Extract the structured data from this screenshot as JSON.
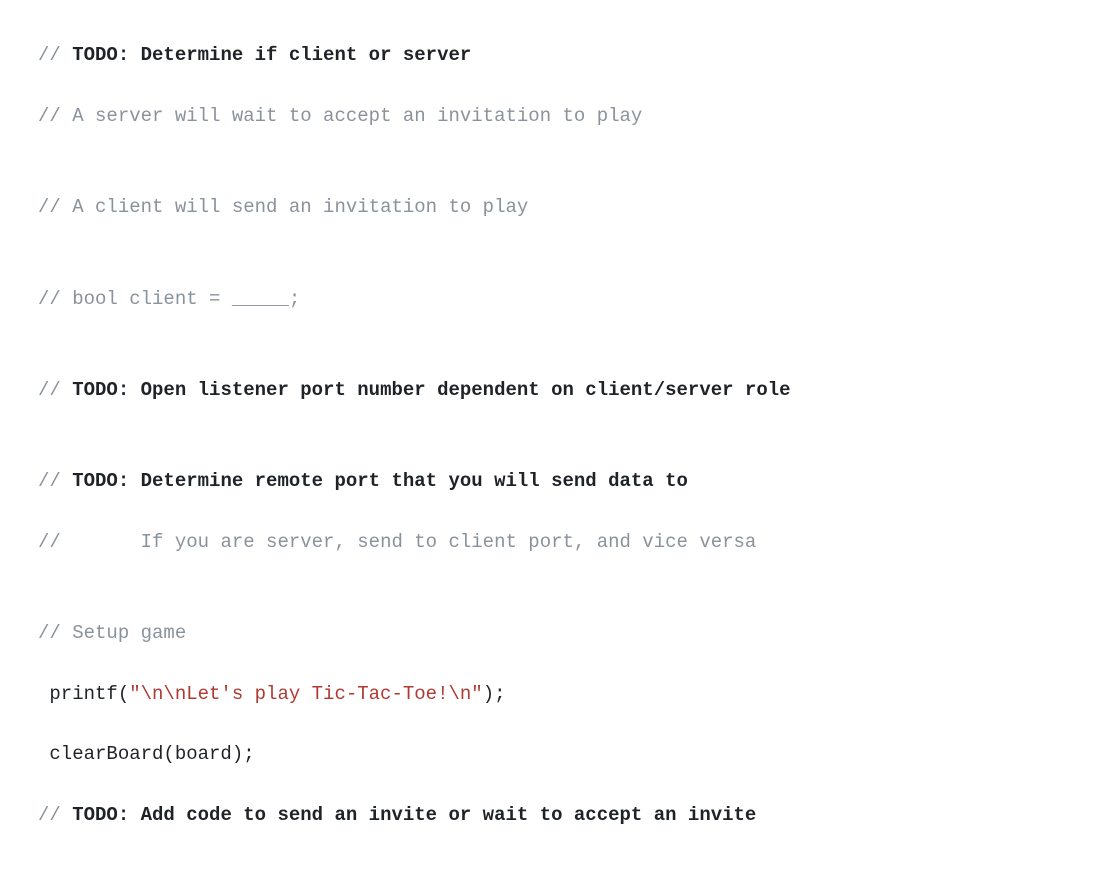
{
  "code": {
    "lines": [
      {
        "slash": "// ",
        "todo": "TODO: Determine if client or server",
        "rest": "",
        "highlight": false
      },
      {
        "slash": "// ",
        "todo": "",
        "rest": "A server will wait to accept an invitation to play",
        "highlight": false
      },
      {
        "slash": "",
        "todo": "",
        "rest": "",
        "highlight": false
      },
      {
        "slash": "// ",
        "todo": "",
        "rest": "A client will send an invitation to play",
        "highlight": false
      },
      {
        "slash": "",
        "todo": "",
        "rest": "",
        "highlight": false
      },
      {
        "slash": "// ",
        "todo": "",
        "rest": "bool client = _____;",
        "highlight": false
      },
      {
        "slash": "",
        "todo": "",
        "rest": "",
        "highlight": false
      },
      {
        "slash": "// ",
        "todo": "TODO: Open listener port number dependent on client/server role",
        "rest": "",
        "highlight": false
      },
      {
        "slash": "",
        "todo": "",
        "rest": "",
        "highlight": false
      },
      {
        "slash": "// ",
        "todo": "TODO: Determine remote port that you will send data to",
        "rest": "",
        "highlight": false
      },
      {
        "slash": "//       ",
        "todo": "",
        "rest": "If you are server, send to client port, and vice versa",
        "highlight": false
      },
      {
        "slash": "",
        "todo": "",
        "rest": "",
        "highlight": true
      },
      {
        "slash": "// ",
        "todo": "",
        "rest": "Setup game",
        "highlight": false
      },
      {
        "printf_pre": " printf(",
        "printf_str": "\"\\n\\nLet's play Tic-Tac-Toe!\\n\"",
        "printf_post": ");",
        "highlight": false,
        "kind": "printf"
      },
      {
        "code": " clearBoard(board);",
        "highlight": false,
        "kind": "code"
      },
      {
        "slash": "// ",
        "todo": "TODO: Add code to send an invite or wait to accept an invite",
        "rest": "",
        "highlight": false
      }
    ]
  }
}
